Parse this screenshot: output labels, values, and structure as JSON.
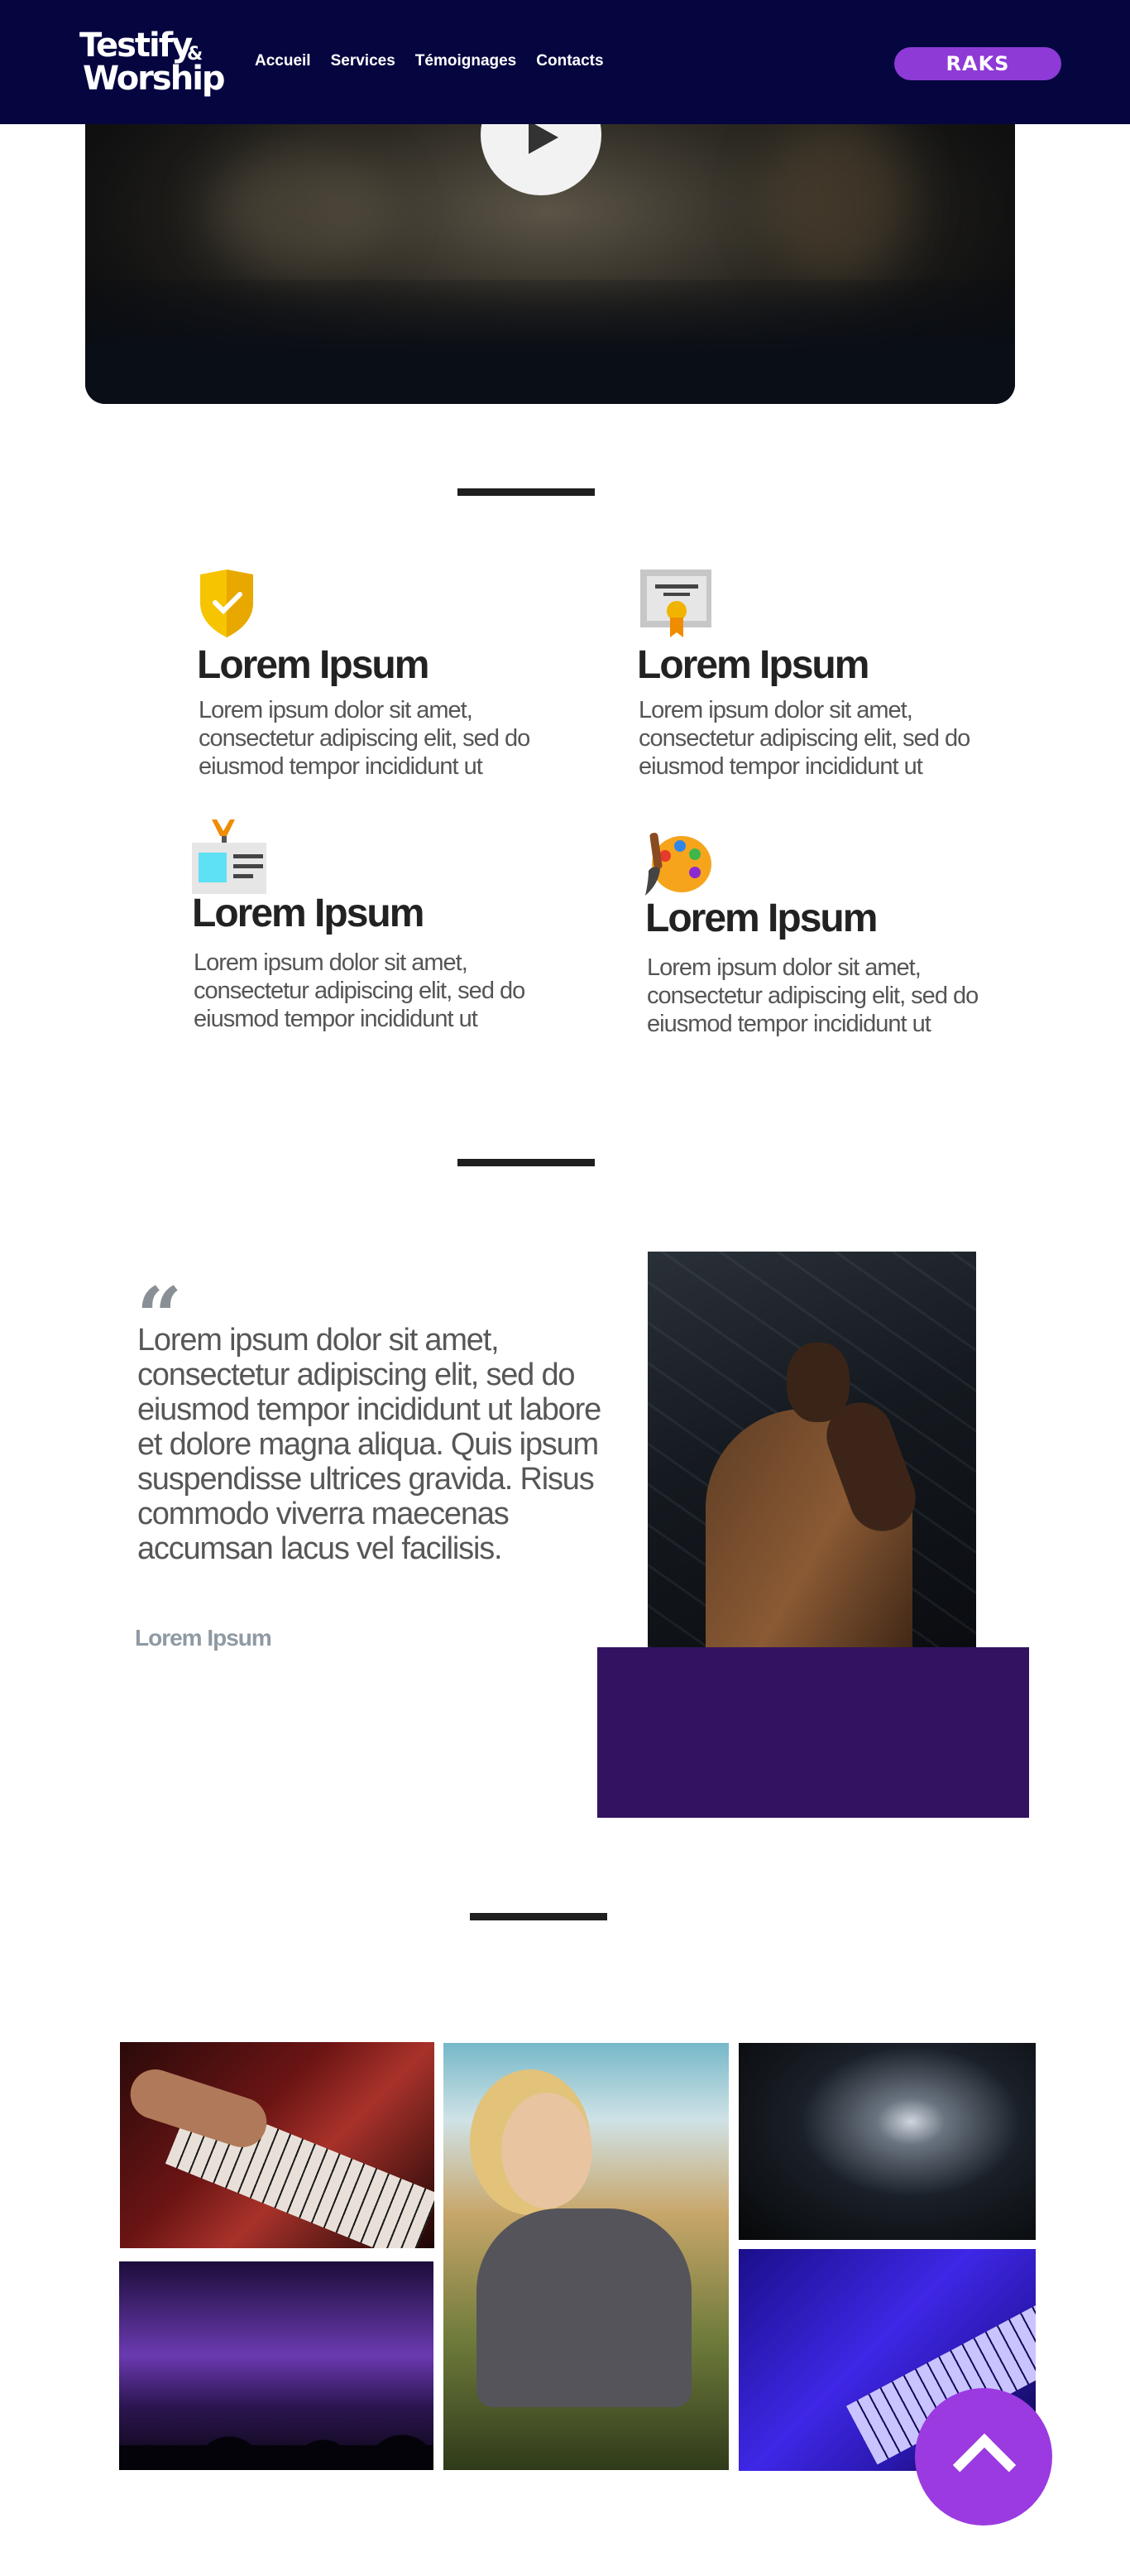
{
  "header": {
    "logo_line1": "Testify",
    "logo_amp": "&",
    "logo_line2": "Worship",
    "nav": [
      "Accueil",
      "Services",
      "Témoignages",
      "Contacts"
    ],
    "cta_label": "RAKS"
  },
  "features": [
    {
      "icon": "shield-check-icon",
      "title": "Lorem Ipsum",
      "text": "Lorem ipsum dolor sit amet, consectetur adipiscing elit, sed do eiusmod tempor incididunt ut"
    },
    {
      "icon": "certificate-icon",
      "title": "Lorem Ipsum",
      "text": "Lorem ipsum dolor sit amet, consectetur adipiscing elit, sed do eiusmod tempor incididunt ut"
    },
    {
      "icon": "id-badge-icon",
      "title": "Lorem Ipsum",
      "text": "Lorem ipsum dolor sit amet, consectetur adipiscing elit, sed do eiusmod tempor incididunt ut"
    },
    {
      "icon": "palette-icon",
      "title": "Lorem Ipsum",
      "text": "Lorem ipsum dolor sit amet, consectetur adipiscing elit, sed do eiusmod tempor incididunt ut"
    }
  ],
  "testimonial": {
    "quote": "Lorem ipsum dolor sit amet, consectetur adipiscing elit, sed do eiusmod tempor incididunt ut labore et dolore magna aliqua. Quis ipsum suspendisse ultrices gravida. Risus commodo viverra maecenas accumsan lacus vel facilisis.",
    "author": "Lorem Ipsum",
    "accent_color": "#331261"
  },
  "colors": {
    "nav_bg": "#050540",
    "accent": "#8e3ad6",
    "text_dark": "#1f1f1f",
    "text_muted": "#575757"
  }
}
